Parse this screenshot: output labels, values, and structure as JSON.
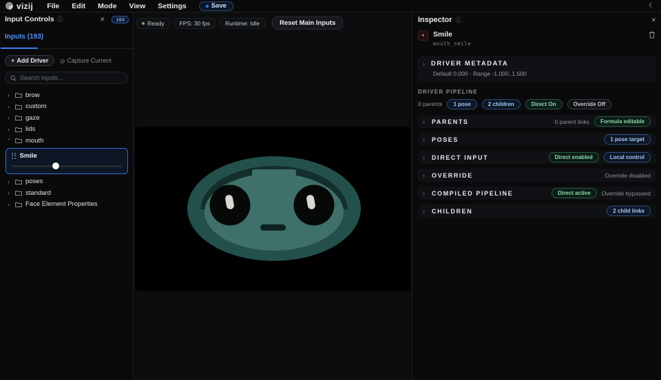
{
  "topbar": {
    "logo_text": "vizij",
    "menus": [
      {
        "label": "File"
      },
      {
        "label": "Edit"
      },
      {
        "label": "Mode"
      },
      {
        "label": "View"
      },
      {
        "label": "Settings"
      }
    ],
    "save_label": "Save",
    "moon_glyph": "☾"
  },
  "left_panel": {
    "title": "Input Controls",
    "info_glyph": "ⓘ",
    "close_glyph": "✕",
    "count_badge": "193",
    "tab_label": "Inputs (193)",
    "add_driver_label": "Add Driver",
    "add_driver_plus": "+",
    "capture_label": "Capture Current",
    "capture_glyph": "◎",
    "search_placeholder": "Search inputs...",
    "tree": [
      {
        "label": "brow",
        "expanded": false
      },
      {
        "label": "custom",
        "expanded": false
      },
      {
        "label": "gaze",
        "expanded": false
      },
      {
        "label": "lids",
        "expanded": false
      },
      {
        "label": "mouth",
        "expanded": true
      },
      {
        "label": "Smile",
        "type": "slider",
        "value_percent": 40
      },
      {
        "label": "poses",
        "expanded": false
      },
      {
        "label": "standard",
        "expanded": false
      },
      {
        "label": "Face Element Properties",
        "expanded": false
      }
    ]
  },
  "status_bar": {
    "ready_label": "Ready",
    "fps_label": "FPS: 30 fps",
    "runtime_label": "Runtime: Idle",
    "reset_label": "Reset Main Inputs"
  },
  "canvas": {
    "background": "#010101",
    "face": {
      "outer": "#24504b",
      "brow_shadow": "#132e2b",
      "skin": "#3f7069",
      "eye": "#070808",
      "highlight": "#d6d8d1",
      "mouth": "#0b2220"
    }
  },
  "inspector": {
    "title": "Inspector",
    "info_glyph": "ⓘ",
    "close_glyph": "✕",
    "item": {
      "name": "Smile",
      "id": "mouth_smile",
      "icon_glyph": "✦"
    },
    "metadata": {
      "title": "DRIVER METADATA",
      "detail": "Default 0.000 · Range -1.000..1.500"
    },
    "pipeline_label": "DRIVER PIPELINE",
    "pipeline_chips": [
      {
        "label": "0 parents",
        "style": "text"
      },
      {
        "label": "1 pose",
        "style": "blue"
      },
      {
        "label": "2 children",
        "style": "blue"
      },
      {
        "label": "Direct On",
        "style": "green"
      },
      {
        "label": "Override Off",
        "style": "gray"
      }
    ],
    "sections": [
      {
        "title": "PARENTS",
        "right": [
          {
            "label": "0 parent links",
            "style": "text"
          },
          {
            "label": "Formula editable",
            "style": "green"
          }
        ]
      },
      {
        "title": "POSES",
        "right": [
          {
            "label": "1 pose target",
            "style": "blue"
          }
        ]
      },
      {
        "title": "DIRECT INPUT",
        "right": [
          {
            "label": "Direct enabled",
            "style": "green"
          },
          {
            "label": "Local control",
            "style": "blue"
          }
        ]
      },
      {
        "title": "OVERRIDE",
        "right": [
          {
            "label": "Override disabled",
            "style": "text"
          }
        ]
      },
      {
        "title": "COMPILED PIPELINE",
        "right": [
          {
            "label": "Direct active",
            "style": "green"
          },
          {
            "label": "Override bypassed",
            "style": "text"
          }
        ]
      },
      {
        "title": "CHILDREN",
        "right": [
          {
            "label": "2 child links",
            "style": "blue"
          }
        ]
      }
    ]
  },
  "colors": {
    "accent_blue": "#3b82f6",
    "chip_blue_text": "#a6c6f5",
    "chip_green_text": "#8fd6ae",
    "selection_border": "#2f6fd0",
    "ready_dot": "#84a385"
  }
}
